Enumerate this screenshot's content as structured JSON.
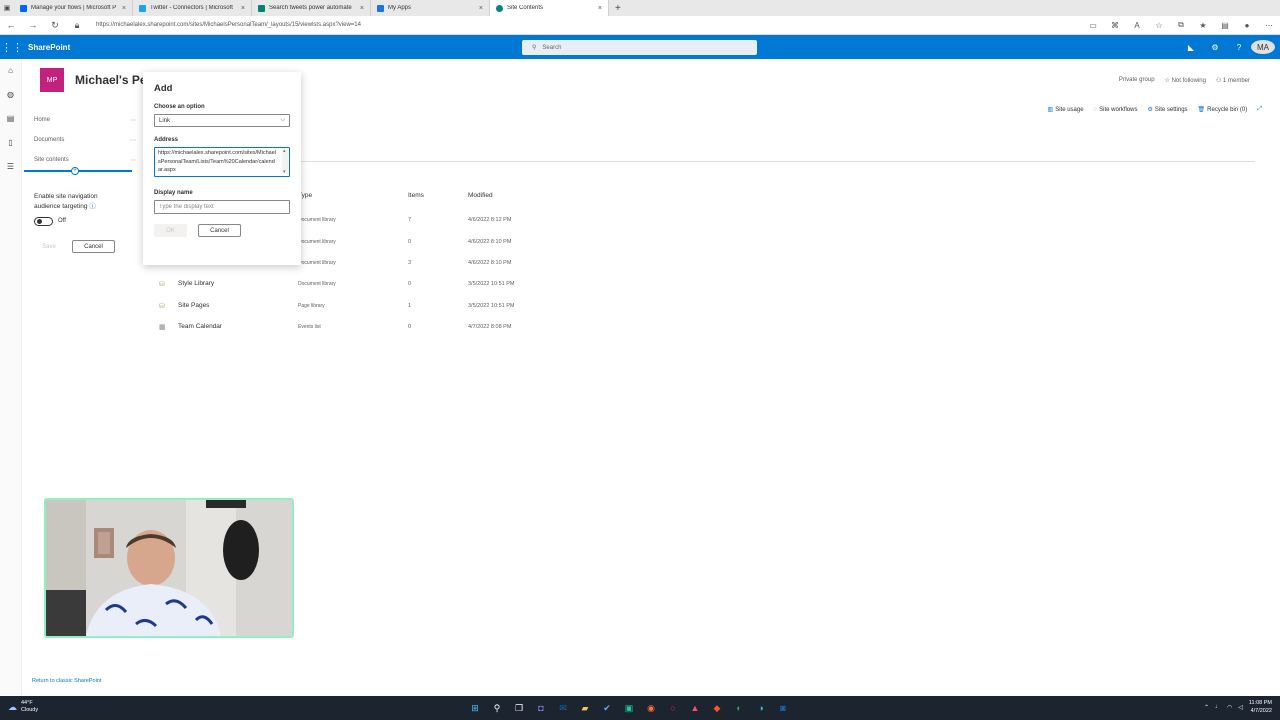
{
  "browser": {
    "tabs": [
      {
        "label": "Manage your flows | Microsoft P",
        "favicon": "power-automate-icon",
        "active": false
      },
      {
        "label": "Twitter - Connectors | Microsoft",
        "favicon": "twitter-icon",
        "active": false
      },
      {
        "label": "Search tweets power automate",
        "favicon": "bing-icon",
        "active": false
      },
      {
        "label": "My Apps",
        "favicon": "apps-icon",
        "active": false
      },
      {
        "label": "Site Contents",
        "favicon": "sharepoint-icon",
        "active": true
      }
    ],
    "url": "https://michaelalex.sharepoint.com/sites/MichaelsPersonalTeam/_layouts/15/viewlsts.aspx?view=14"
  },
  "suite": {
    "app_name": "SharePoint",
    "search_placeholder": "Search",
    "user_initials": "MA",
    "accent": "#0078d4"
  },
  "site": {
    "logo_initials": "MP",
    "logo_color": "#c4217f",
    "title": "Michael's Pe",
    "privacy": "Private group",
    "follow": "Not following",
    "members": "1 member"
  },
  "commands": {
    "site_usage": "Site usage",
    "site_workflows": "Site workflows",
    "site_settings": "Site settings",
    "recycle_bin": "Recycle bin (0)"
  },
  "leftnav": {
    "items": [
      "Home",
      "Documents",
      "Site contents"
    ],
    "audience_label": "Enable site navigation audience targeting",
    "toggle_state": "Off",
    "save": "Save",
    "cancel": "Cancel",
    "return_classic": "Return to classic SharePoint"
  },
  "list": {
    "headers": {
      "type": "Type",
      "items": "Items",
      "modified": "Modified"
    },
    "rows": [
      {
        "name": "",
        "type": "Document library",
        "items": "7",
        "modified": "4/6/2022 8:12 PM",
        "icon": "library-icon"
      },
      {
        "name": "",
        "type": "Document library",
        "items": "0",
        "modified": "4/6/2022 8:10 PM",
        "icon": "library-icon"
      },
      {
        "name": "",
        "type": "Document library",
        "items": "3",
        "modified": "4/6/2022 8:10 PM",
        "icon": "library-icon"
      },
      {
        "name": "Style Library",
        "type": "Document library",
        "items": "0",
        "modified": "3/5/2022 10:51 PM",
        "icon": "library-icon"
      },
      {
        "name": "Site Pages",
        "type": "Page library",
        "items": "1",
        "modified": "3/5/2022 10:51 PM",
        "icon": "library-icon"
      },
      {
        "name": "Team Calendar",
        "type": "Events list",
        "items": "0",
        "modified": "4/7/2022 8:08 PM",
        "icon": "calendar-icon"
      }
    ]
  },
  "dialog": {
    "title": "Add",
    "option_label": "Choose an option",
    "option_value": "Link",
    "address_label": "Address",
    "address_value": "https://michaelalex.sharepoint.com/sites/MichaelsPersonalTeam/Lists/Team%20Calendar/calendar.aspx",
    "display_label": "Display name",
    "display_placeholder": "Type the display text",
    "ok": "OK",
    "cancel": "Cancel"
  },
  "taskbar": {
    "temperature": "44°F",
    "weather": "Cloudy",
    "time": "11:08 PM",
    "date": "4/7/2022"
  }
}
